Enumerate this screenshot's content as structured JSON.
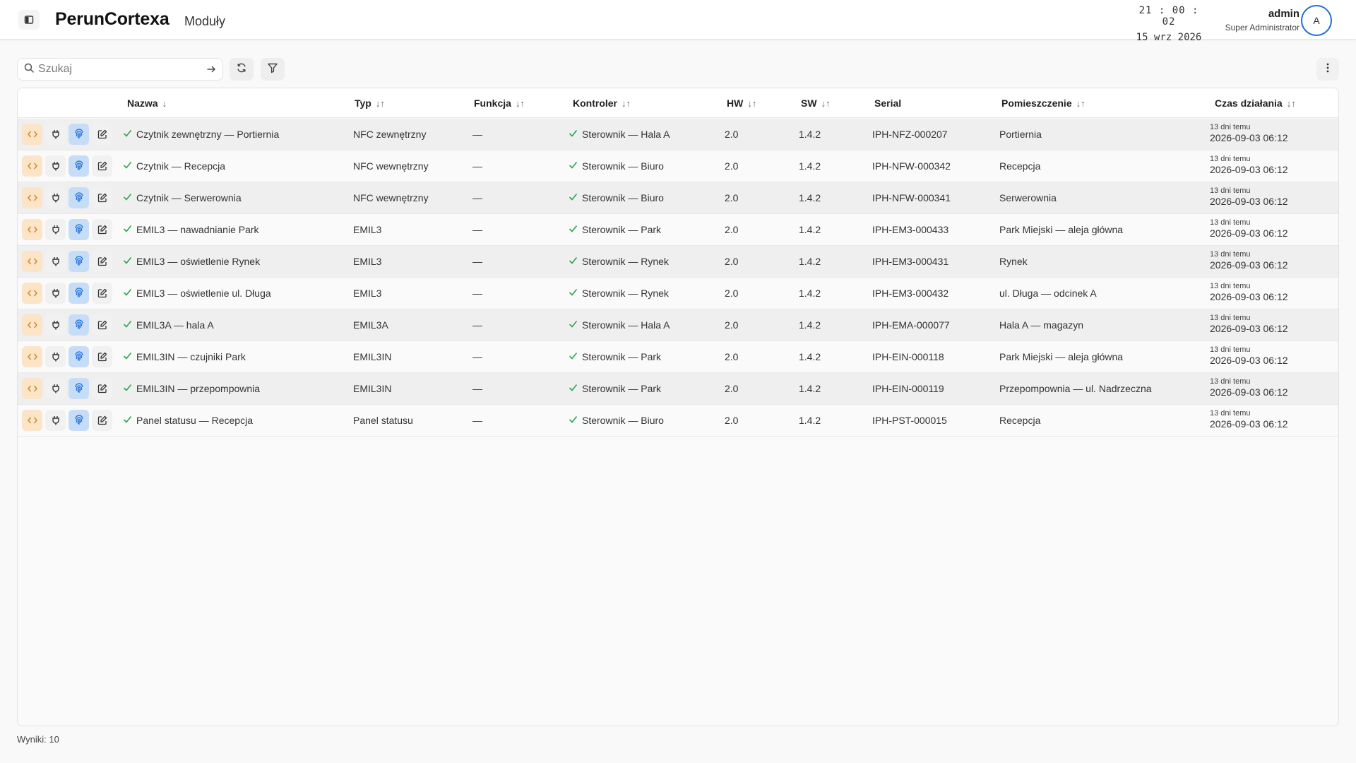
{
  "app": {
    "title": "PerunCortexa",
    "page": "Moduły"
  },
  "clock": {
    "time": "21 : 00 : 02",
    "date": "15 wrz 2026"
  },
  "user": {
    "name": "admin",
    "role": "Super Administrator",
    "initial": "A"
  },
  "search": {
    "placeholder": "Szukaj",
    "value": ""
  },
  "columns": [
    {
      "label": "Nazwa",
      "sort": "↓"
    },
    {
      "label": "Typ",
      "sort": "↓↑"
    },
    {
      "label": "Funkcja",
      "sort": "↓↑"
    },
    {
      "label": "Kontroler",
      "sort": "↓↑"
    },
    {
      "label": "HW",
      "sort": "↓↑"
    },
    {
      "label": "SW",
      "sort": "↓↑"
    },
    {
      "label": "Serial",
      "sort": ""
    },
    {
      "label": "Pomieszczenie",
      "sort": "↓↑"
    },
    {
      "label": "Czas działania",
      "sort": "↓↑"
    }
  ],
  "rows": [
    {
      "name": "Czytnik zewnętrzny — Portiernia",
      "type": "NFC zewnętrzny",
      "function": "—",
      "controller": "Sterownik — Hala A",
      "hw": "2.0",
      "sw": "1.4.2",
      "serial": "IPH-NFZ-000207",
      "room": "Portiernia",
      "uptime_rel": "13 dni temu",
      "uptime_abs": "2026-09-03 06:12"
    },
    {
      "name": "Czytnik — Recepcja",
      "type": "NFC wewnętrzny",
      "function": "—",
      "controller": "Sterownik — Biuro",
      "hw": "2.0",
      "sw": "1.4.2",
      "serial": "IPH-NFW-000342",
      "room": "Recepcja",
      "uptime_rel": "13 dni temu",
      "uptime_abs": "2026-09-03 06:12"
    },
    {
      "name": "Czytnik — Serwerownia",
      "type": "NFC wewnętrzny",
      "function": "—",
      "controller": "Sterownik — Biuro",
      "hw": "2.0",
      "sw": "1.4.2",
      "serial": "IPH-NFW-000341",
      "room": "Serwerownia",
      "uptime_rel": "13 dni temu",
      "uptime_abs": "2026-09-03 06:12"
    },
    {
      "name": "EMIL3 — nawadnianie Park",
      "type": "EMIL3",
      "function": "—",
      "controller": "Sterownik — Park",
      "hw": "2.0",
      "sw": "1.4.2",
      "serial": "IPH-EM3-000433",
      "room": "Park Miejski — aleja główna",
      "uptime_rel": "13 dni temu",
      "uptime_abs": "2026-09-03 06:12"
    },
    {
      "name": "EMIL3 — oświetlenie Rynek",
      "type": "EMIL3",
      "function": "—",
      "controller": "Sterownik — Rynek",
      "hw": "2.0",
      "sw": "1.4.2",
      "serial": "IPH-EM3-000431",
      "room": "Rynek",
      "uptime_rel": "13 dni temu",
      "uptime_abs": "2026-09-03 06:12"
    },
    {
      "name": "EMIL3 — oświetlenie ul. Długa",
      "type": "EMIL3",
      "function": "—",
      "controller": "Sterownik — Rynek",
      "hw": "2.0",
      "sw": "1.4.2",
      "serial": "IPH-EM3-000432",
      "room": "ul. Długa — odcinek A",
      "uptime_rel": "13 dni temu",
      "uptime_abs": "2026-09-03 06:12"
    },
    {
      "name": "EMIL3A — hala A",
      "type": "EMIL3A",
      "function": "—",
      "controller": "Sterownik — Hala A",
      "hw": "2.0",
      "sw": "1.4.2",
      "serial": "IPH-EMA-000077",
      "room": "Hala A — magazyn",
      "uptime_rel": "13 dni temu",
      "uptime_abs": "2026-09-03 06:12"
    },
    {
      "name": "EMIL3IN — czujniki Park",
      "type": "EMIL3IN",
      "function": "—",
      "controller": "Sterownik — Park",
      "hw": "2.0",
      "sw": "1.4.2",
      "serial": "IPH-EIN-000118",
      "room": "Park Miejski — aleja główna",
      "uptime_rel": "13 dni temu",
      "uptime_abs": "2026-09-03 06:12"
    },
    {
      "name": "EMIL3IN — przepompownia",
      "type": "EMIL3IN",
      "function": "—",
      "controller": "Sterownik — Park",
      "hw": "2.0",
      "sw": "1.4.2",
      "serial": "IPH-EIN-000119",
      "room": "Przepompownia — ul. Nadrzeczna",
      "uptime_rel": "13 dni temu",
      "uptime_abs": "2026-09-03 06:12"
    },
    {
      "name": "Panel statusu — Recepcja",
      "type": "Panel statusu",
      "function": "—",
      "controller": "Sterownik — Biuro",
      "hw": "2.0",
      "sw": "1.4.2",
      "serial": "IPH-PST-000015",
      "room": "Recepcja",
      "uptime_rel": "13 dni temu",
      "uptime_abs": "2026-09-03 06:12"
    }
  ],
  "footer": {
    "count": "Wyniki: 10"
  },
  "colors": {
    "accent": "#1e6fd9",
    "success": "#2ea44f",
    "code_bg": "#fbe4c7",
    "fingerprint_bg": "#c7ddf7"
  },
  "icons": {
    "row_actions": [
      "code-icon",
      "plug-icon",
      "fingerprint-icon",
      "edit-icon"
    ],
    "status": "check-icon"
  }
}
